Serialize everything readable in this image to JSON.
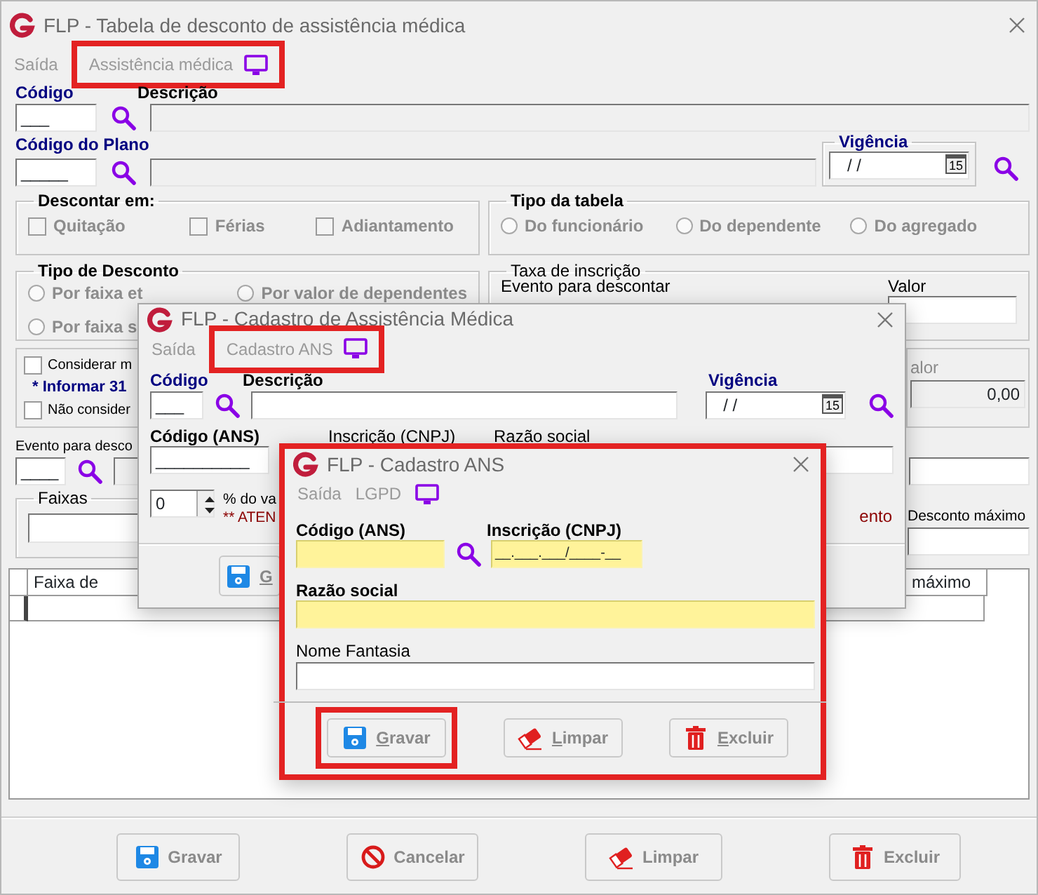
{
  "main_window": {
    "title": "FLP - Tabela de desconto de assistência médica",
    "menu": [
      {
        "label": "Saída",
        "annotated": false
      },
      {
        "label": "Assistência médica",
        "annotated": true
      }
    ],
    "codigo": {
      "label": "Código",
      "value": "___"
    },
    "descricao": {
      "label": "Descrição"
    },
    "codigo_plano": {
      "label": "Código do Plano",
      "value": "_____"
    },
    "vigencia": {
      "label": "Vigência",
      "value": "/ /",
      "calendar": "15"
    },
    "descontar_em": {
      "title": "Descontar em:",
      "options": [
        {
          "label": "Quitação",
          "checked": false,
          "disabled": true
        },
        {
          "label": "Férias",
          "checked": false,
          "disabled": true
        },
        {
          "label": "Adiantamento",
          "checked": false,
          "disabled": true
        }
      ]
    },
    "tipo_tabela": {
      "title": "Tipo da tabela",
      "options": [
        {
          "label": "Do funcionário",
          "selected": false,
          "disabled": true
        },
        {
          "label": "Do dependente",
          "selected": false,
          "disabled": true
        },
        {
          "label": "Do agregado",
          "selected": false,
          "disabled": true
        }
      ]
    },
    "tipo_desconto": {
      "title": "Tipo de Desconto",
      "options": [
        {
          "label": "Por faixa et",
          "selected": false,
          "disabled": true
        },
        {
          "label": "Por valor de dependentes",
          "selected": false,
          "disabled": true
        },
        {
          "label": "Por faixa s",
          "selected": false,
          "disabled": true
        }
      ]
    },
    "taxa_inscricao": {
      "title": "Taxa de inscrição",
      "event_label": "Evento para descontar",
      "value_label": "Valor"
    },
    "options_box": [
      {
        "kind": "checkbox",
        "label": "Considerar m",
        "checked": false
      },
      {
        "kind": "note",
        "label": "* Informar 31"
      },
      {
        "kind": "checkbox",
        "label": "Não consider",
        "checked": false
      }
    ],
    "valor_box": {
      "label": "alor",
      "value": "0,00"
    },
    "evento": {
      "label": "Evento para desco",
      "value": "____"
    },
    "faixas": {
      "title": "Faixas"
    },
    "desconto_maximo": {
      "label": "Desconto máximo"
    },
    "table": {
      "columns": [
        "Faixa de",
        "máximo"
      ]
    },
    "buttons": [
      {
        "label": "Gravar",
        "kind": "save",
        "disabled": true,
        "annotated": false
      },
      {
        "label": "Cancelar",
        "kind": "cancel",
        "disabled": true,
        "annotated": false
      },
      {
        "label": "Limpar",
        "kind": "eraser",
        "disabled": true,
        "annotated": false
      },
      {
        "label": "Excluir",
        "kind": "trash",
        "disabled": true,
        "annotated": false
      }
    ]
  },
  "assist_window": {
    "title": "FLP - Cadastro de Assistência Médica",
    "menu": [
      {
        "label": "Saída",
        "annotated": false
      },
      {
        "label": "Cadastro ANS",
        "annotated": true
      }
    ],
    "codigo": {
      "label": "Código",
      "value": "___"
    },
    "descricao": {
      "label": "Descrição"
    },
    "vigencia": {
      "label": "Vigência",
      "value": "/ /",
      "calendar": "15"
    },
    "codigo_ans": {
      "label": "Código (ANS)",
      "value": "__________"
    },
    "inscricao_label": "Inscrição (CNPJ)",
    "razao_label": "Razão social",
    "percent": {
      "value": "0",
      "label": "% do va",
      "warning": "** ATEN",
      "warning_end": "ento"
    },
    "buttons": [
      {
        "label": "G",
        "kind": "save",
        "disabled": true,
        "annotated": false
      }
    ]
  },
  "ans_window": {
    "title": "FLP - Cadastro ANS",
    "annotated": true,
    "menu": [
      {
        "label": "Saída",
        "annotated": false
      },
      {
        "label": "LGPD",
        "annotated": false
      }
    ],
    "codigo_ans": {
      "label": "Código (ANS)",
      "required": true
    },
    "cnpj": {
      "label": "Inscrição (CNPJ)",
      "value": "__.___.___/____-__",
      "required": true
    },
    "razao": {
      "label": "Razão social",
      "required": true
    },
    "nome_fantasia": {
      "label": "Nome Fantasia",
      "required": false
    },
    "buttons": [
      {
        "label": "Gravar",
        "kind": "save",
        "disabled": true,
        "annotated": true
      },
      {
        "label": "Limpar",
        "kind": "eraser",
        "disabled": true,
        "annotated": false
      },
      {
        "label": "Excluir",
        "kind": "trash",
        "disabled": true,
        "annotated": false
      }
    ]
  }
}
